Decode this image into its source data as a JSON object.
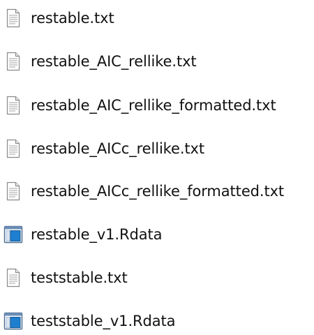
{
  "files": [
    {
      "name": "restable.txt",
      "icon": "text-file-icon"
    },
    {
      "name": "restable_AIC_rellike.txt",
      "icon": "text-file-icon"
    },
    {
      "name": "restable_AIC_rellike_formatted.txt",
      "icon": "text-file-icon"
    },
    {
      "name": "restable_AICc_rellike.txt",
      "icon": "text-file-icon"
    },
    {
      "name": "restable_AICc_rellike_formatted.txt",
      "icon": "text-file-icon"
    },
    {
      "name": "restable_v1.Rdata",
      "icon": "rdata-file-icon"
    },
    {
      "name": "teststable.txt",
      "icon": "text-file-icon"
    },
    {
      "name": "teststable_v1.Rdata",
      "icon": "rdata-file-icon"
    }
  ],
  "colors": {
    "rdata_accent": "#1e7fd0",
    "text_file_outline": "#8a8a8a"
  }
}
